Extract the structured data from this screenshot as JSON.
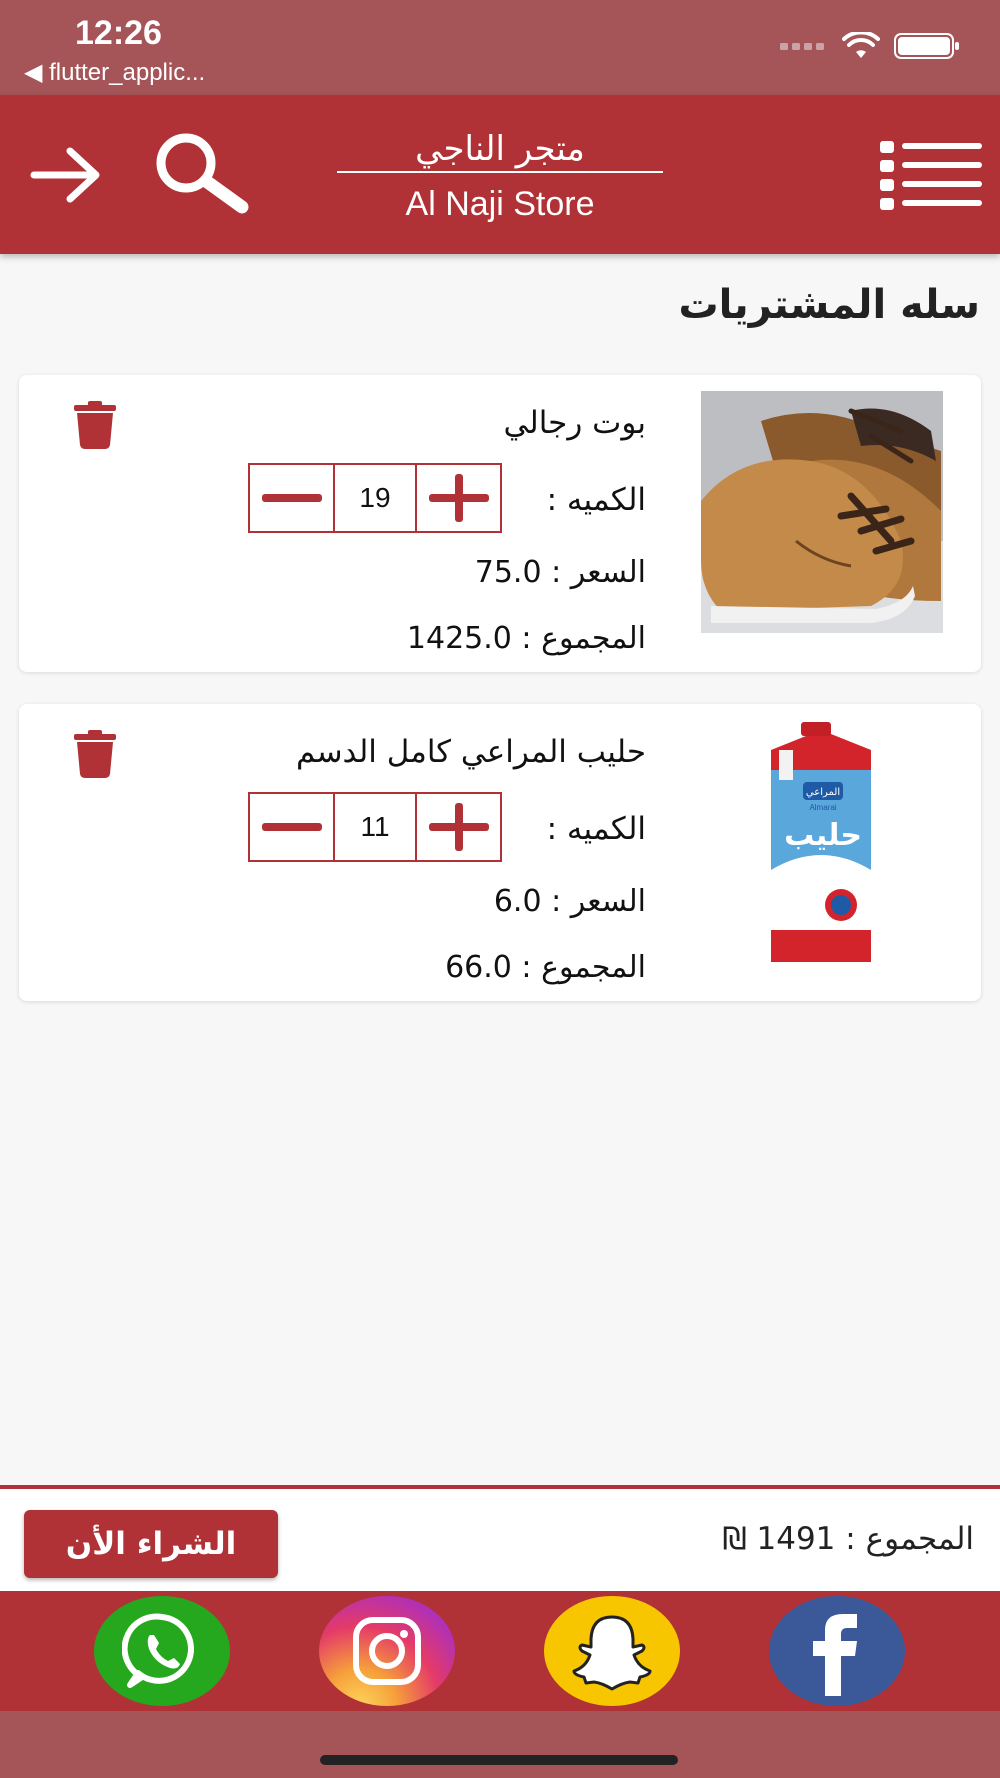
{
  "status_bar": {
    "time": "12:26",
    "back_app": "◀ flutter_applic..."
  },
  "header": {
    "title_ar": "متجر الناجي",
    "title_en": "Al Naji Store"
  },
  "page": {
    "title": "سله المشتريات"
  },
  "cart": {
    "items": [
      {
        "name": "بوت رجالي",
        "qty_label": "الكميه :",
        "quantity": "19",
        "price_line": "السعر : 75.0",
        "total_line": "المجموع : 1425.0"
      },
      {
        "name": "حليب المراعي كامل الدسم",
        "qty_label": "الكميه :",
        "quantity": "11",
        "price_line": "السعر : 6.0",
        "total_line": "المجموع : 66.0",
        "carton_brand": "المراعي",
        "carton_brand_en": "Almarai",
        "carton_product": "حليب"
      }
    ]
  },
  "summary": {
    "total_text": "المجموع : 1491 ₪",
    "buy_label": "الشراء الأن"
  },
  "social": [
    {
      "name": "whatsapp",
      "color": "#25a81e"
    },
    {
      "name": "instagram",
      "color": "#d62a7f"
    },
    {
      "name": "snapchat",
      "color": "#f7c600"
    },
    {
      "name": "facebook",
      "color": "#3b5999"
    }
  ],
  "colors": {
    "primary": "#b03236",
    "status_bar": "#a55458",
    "background": "#f7f7f7"
  }
}
